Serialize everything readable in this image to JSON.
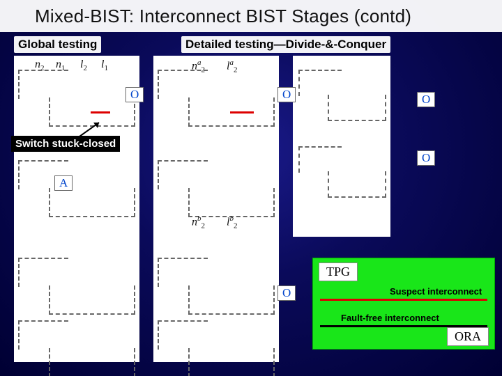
{
  "title": "Mixed-BIST: Interconnect BIST Stages (contd)",
  "subheads": {
    "left": "Global testing",
    "right": "Detailed testing—Divide-&-Conquer"
  },
  "panel1_vars": {
    "a": "n",
    "a_sub": "2",
    "b": "n",
    "b_sub": "1",
    "c": "l",
    "c_sub": "2",
    "d": "l",
    "d_sub": "1"
  },
  "panel2_top_vars": {
    "a": "n",
    "a_sup": "a",
    "a_sub": "2",
    "b": "l",
    "b_sup": "a",
    "b_sub": "2"
  },
  "panel2_bot_vars": {
    "a": "n",
    "a_sup": "b",
    "a_sub": "2",
    "b": "l",
    "b_sup": "b",
    "b_sub": "2"
  },
  "badges": {
    "O": "O",
    "A": "A"
  },
  "switch_label": "Switch stuck-closed",
  "legend": {
    "tpg": "TPG",
    "ora": "ORA",
    "suspect": "Suspect interconnect",
    "faultfree": "Fault-free interconnect"
  }
}
